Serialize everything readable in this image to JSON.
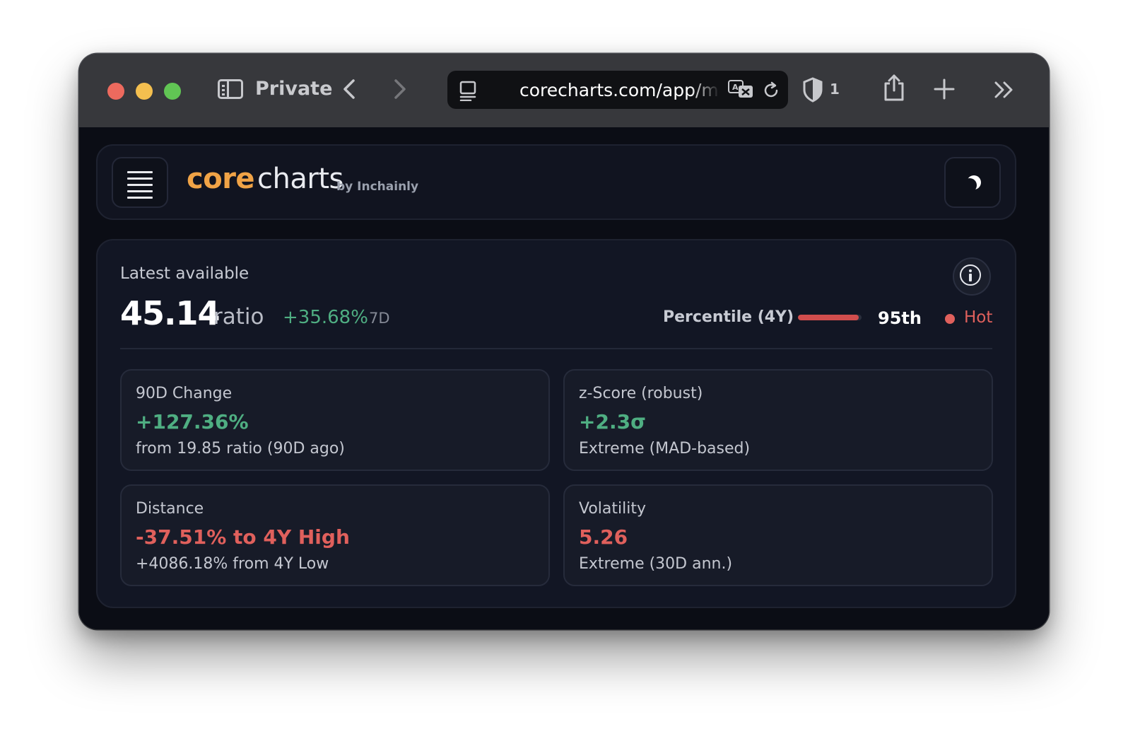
{
  "browser": {
    "private_label": "Private",
    "url": "corecharts.com/app/metrics",
    "shield_count": "1"
  },
  "app": {
    "logo_core": "core",
    "logo_charts": "charts",
    "logo_by": "by Inchainly"
  },
  "summary": {
    "latest_label": "Latest available",
    "value": "45.14",
    "unit": "ratio",
    "delta": "+35.68%",
    "delta_period": "7D",
    "percentile_label": "Percentile (4Y)",
    "percentile_value": "95th",
    "percentile_fraction": 0.95,
    "heat_label": "Hot"
  },
  "stats": [
    {
      "title": "90D Change",
      "value": "+127.36%",
      "sub": "from 19.85 ratio (90D ago)",
      "tone": "positive"
    },
    {
      "title": "z-Score (robust)",
      "value": "+2.3σ",
      "sub": "Extreme (MAD-based)",
      "tone": "positive"
    },
    {
      "title": "Distance",
      "value": "-37.51% to 4Y High",
      "sub": "+4086.18% from 4Y Low",
      "tone": "negative"
    },
    {
      "title": "Volatility",
      "value": "5.26",
      "sub": "Extreme (30D ann.)",
      "tone": "negative"
    }
  ],
  "colors": {
    "positive": "#4fae82",
    "negative": "#e0605c",
    "hot": "#e0605c",
    "brand": "#f0a346"
  }
}
